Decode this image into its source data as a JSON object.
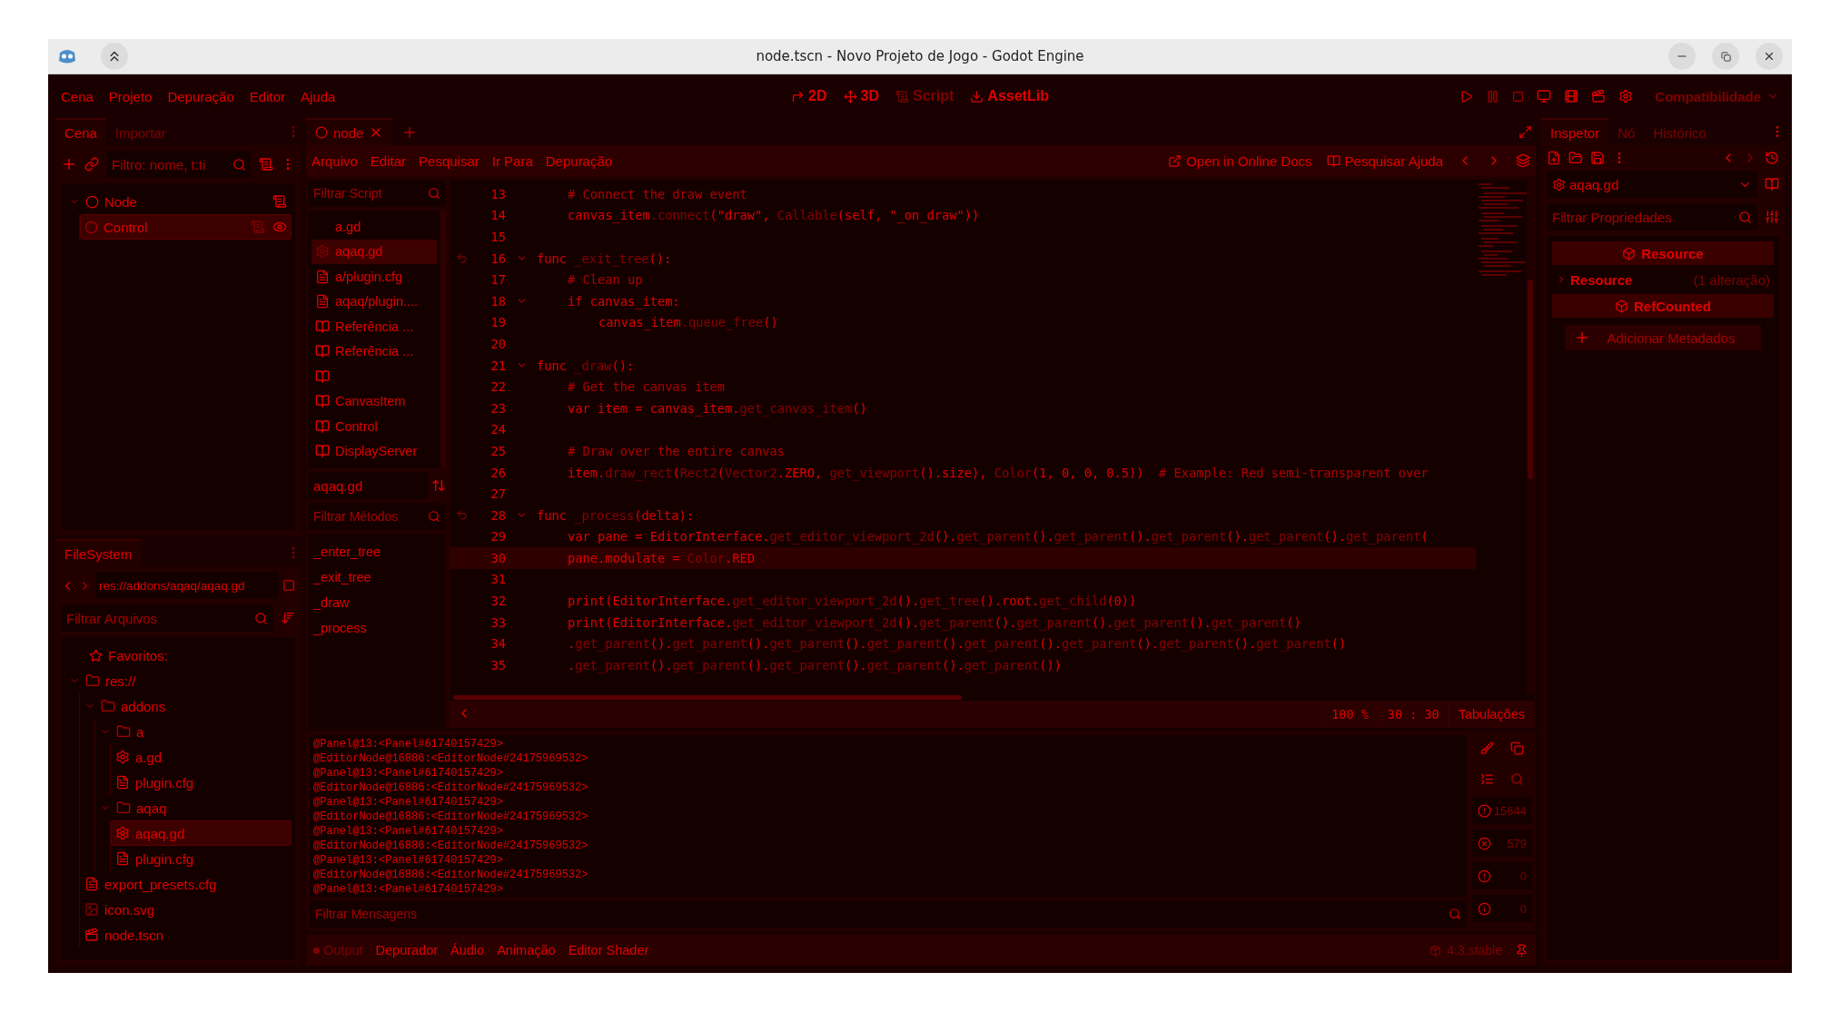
{
  "window": {
    "title": "node.tscn - Novo Projeto de Jogo - Godot Engine"
  },
  "menu": [
    "Cena",
    "Projeto",
    "Depuração",
    "Editor",
    "Ajuda"
  ],
  "workspaces": [
    {
      "label": "2D",
      "kind": "flat",
      "selected": false
    },
    {
      "label": "3D",
      "kind": "space",
      "selected": false
    },
    {
      "label": "Script",
      "kind": "script",
      "selected": true
    },
    {
      "label": "AssetLib",
      "kind": "assetlib",
      "selected": false
    }
  ],
  "renderer": "Compatibilidade",
  "scene_dock": {
    "tabs": [
      {
        "label": "Cena",
        "selected": true
      },
      {
        "label": "Importar",
        "selected": false
      }
    ],
    "filter_placeholder": "Filtro: nome, t:ti",
    "tree": [
      {
        "label": "Node",
        "kind": "root",
        "selected": false,
        "expanded": true,
        "children": [
          {
            "label": "Control",
            "kind": "child",
            "selected": true
          }
        ]
      }
    ]
  },
  "filesystem": {
    "tabs": [
      {
        "label": "FileSystem",
        "selected": true
      }
    ],
    "path": "res://addons/aqaq/aqaq.gd",
    "filter_placeholder": "Filtrar Arquivos",
    "favorites": "Favoritos:",
    "tree": [
      {
        "label": "res://",
        "kind": "folder",
        "selected": false,
        "expanded": true,
        "children": [
          {
            "label": "addons",
            "kind": "folder",
            "selected": false,
            "expanded": true,
            "children": [
              {
                "label": "a",
                "kind": "folder",
                "selected": false,
                "expanded": true,
                "children": [
                  {
                    "label": "a.gd",
                    "kind": "script",
                    "selected": false
                  },
                  {
                    "label": "plugin.cfg",
                    "kind": "config",
                    "selected": false
                  }
                ]
              },
              {
                "label": "aqaq",
                "kind": "folder",
                "selected": false,
                "expanded": true,
                "children": [
                  {
                    "label": "aqaq.gd",
                    "kind": "script",
                    "selected": true
                  },
                  {
                    "label": "plugin.cfg",
                    "kind": "config",
                    "selected": false
                  }
                ]
              }
            ]
          },
          {
            "label": "export_presets.cfg",
            "kind": "config",
            "selected": false
          },
          {
            "label": "icon.svg",
            "kind": "image",
            "selected": false
          },
          {
            "label": "node.tscn",
            "kind": "scene",
            "selected": false
          }
        ]
      }
    ]
  },
  "editor_tabs": [
    {
      "label": "node",
      "selected": true
    }
  ],
  "script_menu": [
    "Arquivo",
    "Editar",
    "Pesquisar",
    "Ir Para",
    "Depuração"
  ],
  "script_links": [
    {
      "label": "Open in Online Docs",
      "kind": "online"
    },
    {
      "label": "Pesquisar Ajuda",
      "kind": "help"
    }
  ],
  "script_list": {
    "filter_placeholder": "Filtrar Script",
    "items": [
      {
        "label": "a.gd",
        "kind": "plain",
        "selected": false
      },
      {
        "label": "aqaq.gd",
        "kind": "script",
        "selected": true
      },
      {
        "label": "a/plugin.cfg",
        "kind": "config",
        "selected": false
      },
      {
        "label": "aqaq/plugin....",
        "kind": "config",
        "selected": false
      },
      {
        "label": "Referência ...",
        "kind": "doc",
        "selected": false
      },
      {
        "label": "Referência ...",
        "kind": "doc",
        "selected": false
      },
      {
        "kind": "doc",
        "selected": false
      },
      {
        "label": "CanvasItem",
        "kind": "doc",
        "selected": false
      },
      {
        "label": "Control",
        "kind": "doc",
        "selected": false
      },
      {
        "label": "DisplayServer",
        "kind": "doc",
        "selected": false
      }
    ],
    "current": "aqaq.gd",
    "methods_placeholder": "Filtrar Métodos",
    "methods": [
      "_enter_tree",
      "_exit_tree",
      "_draw",
      "_process"
    ]
  },
  "code": [
    {
      "n": "13",
      "fold": false,
      "override": false,
      "current": false,
      "segs": [
        {
          "t": "\t# Connect the draw event",
          "kind": "comment"
        }
      ]
    },
    {
      "n": "14",
      "fold": false,
      "override": false,
      "current": false,
      "segs": [
        {
          "t": "\tcanvas_item",
          "kind": "plain"
        },
        {
          "t": ".connect",
          "kind": "call"
        },
        {
          "t": "(\"draw\", ",
          "kind": "plain"
        },
        {
          "t": "Callable",
          "kind": "call"
        },
        {
          "t": "(self, \"_on_draw\"))",
          "kind": "plain"
        }
      ]
    },
    {
      "n": "15",
      "fold": false,
      "override": false,
      "current": false
    },
    {
      "n": "16",
      "fold": true,
      "override": true,
      "current": false,
      "segs": [
        {
          "t": "func ",
          "kind": "plain"
        },
        {
          "t": "_exit_tree",
          "kind": "call"
        },
        {
          "t": "():",
          "kind": "plain"
        }
      ]
    },
    {
      "n": "17",
      "fold": false,
      "override": false,
      "current": false,
      "segs": [
        {
          "t": "\t# Clean up",
          "kind": "comment"
        }
      ]
    },
    {
      "n": "18",
      "fold": true,
      "override": false,
      "current": false,
      "segs": [
        {
          "t": "\tif canvas_item:",
          "kind": "plain"
        }
      ]
    },
    {
      "n": "19",
      "fold": false,
      "override": false,
      "current": false,
      "segs": [
        {
          "t": "\t\tcanvas_item",
          "kind": "plain"
        },
        {
          "t": ".queue_free",
          "kind": "call"
        },
        {
          "t": "()",
          "kind": "plain"
        }
      ]
    },
    {
      "n": "20",
      "fold": false,
      "override": false,
      "current": false
    },
    {
      "n": "21",
      "fold": true,
      "override": false,
      "current": false,
      "segs": [
        {
          "t": "func ",
          "kind": "plain"
        },
        {
          "t": "_draw",
          "kind": "call"
        },
        {
          "t": "():",
          "kind": "plain"
        }
      ]
    },
    {
      "n": "22",
      "fold": false,
      "override": false,
      "current": false,
      "segs": [
        {
          "t": "\t# Get the canvas item",
          "kind": "comment"
        }
      ]
    },
    {
      "n": "23",
      "fold": false,
      "override": false,
      "current": false,
      "segs": [
        {
          "t": "\tvar item = canvas_item.",
          "kind": "plain"
        },
        {
          "t": "get_canvas_item",
          "kind": "call"
        },
        {
          "t": "()",
          "kind": "plain"
        }
      ]
    },
    {
      "n": "24",
      "fold": false,
      "override": false,
      "current": false
    },
    {
      "n": "25",
      "fold": false,
      "override": false,
      "current": false,
      "segs": [
        {
          "t": "\t# Draw over the entire canvas",
          "kind": "comment"
        }
      ]
    },
    {
      "n": "26",
      "fold": false,
      "override": false,
      "current": false,
      "segs": [
        {
          "t": "\titem.",
          "kind": "plain"
        },
        {
          "t": "draw_rect",
          "kind": "call"
        },
        {
          "t": "(",
          "kind": "plain"
        },
        {
          "t": "Rect2",
          "kind": "call"
        },
        {
          "t": "(",
          "kind": "plain"
        },
        {
          "t": "Vector2",
          "kind": "call"
        },
        {
          "t": ".ZERO, ",
          "kind": "plain"
        },
        {
          "t": "get_viewport",
          "kind": "call"
        },
        {
          "t": "().size), ",
          "kind": "plain"
        },
        {
          "t": "Color",
          "kind": "call"
        },
        {
          "t": "(1, 0, 0, 0.5))  ",
          "kind": "plain"
        },
        {
          "t": "# Example: Red semi-transparent over",
          "kind": "comment"
        }
      ]
    },
    {
      "n": "27",
      "fold": false,
      "override": false,
      "current": false
    },
    {
      "n": "28",
      "fold": true,
      "override": true,
      "current": false,
      "segs": [
        {
          "t": "func ",
          "kind": "plain"
        },
        {
          "t": "_process",
          "kind": "call"
        },
        {
          "t": "(delta):",
          "kind": "plain"
        }
      ]
    },
    {
      "n": "29",
      "fold": false,
      "override": false,
      "current": false,
      "segs": [
        {
          "t": "\tvar pane = EditorInterface.",
          "kind": "plain"
        },
        {
          "t": "get_editor_viewport_2d",
          "kind": "call"
        },
        {
          "t": "().",
          "kind": "plain"
        },
        {
          "t": "get_parent",
          "kind": "call"
        },
        {
          "t": "().",
          "kind": "plain"
        },
        {
          "t": "get_parent",
          "kind": "call"
        },
        {
          "t": "().",
          "kind": "plain"
        },
        {
          "t": "get_parent",
          "kind": "call"
        },
        {
          "t": "().",
          "kind": "plain"
        },
        {
          "t": "get_parent",
          "kind": "call"
        },
        {
          "t": "().",
          "kind": "plain"
        },
        {
          "t": "get_parent",
          "kind": "call"
        },
        {
          "t": "(",
          "kind": "plain"
        }
      ]
    },
    {
      "n": "30",
      "fold": false,
      "override": false,
      "current": true,
      "segs": [
        {
          "t": "\tpane.modulate = ",
          "kind": "plain"
        },
        {
          "t": "Color",
          "kind": "call"
        },
        {
          "t": ".RED",
          "kind": "plain"
        }
      ]
    },
    {
      "n": "31",
      "fold": false,
      "override": false,
      "current": false
    },
    {
      "n": "32",
      "fold": false,
      "override": false,
      "current": false,
      "segs": [
        {
          "t": "\tprint(EditorInterface.",
          "kind": "plain"
        },
        {
          "t": "get_editor_viewport_2d",
          "kind": "call"
        },
        {
          "t": "().",
          "kind": "plain"
        },
        {
          "t": "get_tree",
          "kind": "call"
        },
        {
          "t": "().root.",
          "kind": "plain"
        },
        {
          "t": "get_child",
          "kind": "call"
        },
        {
          "t": "(0))",
          "kind": "plain"
        }
      ]
    },
    {
      "n": "33",
      "fold": false,
      "override": false,
      "current": false,
      "segs": [
        {
          "t": "\tprint(EditorInterface.",
          "kind": "plain"
        },
        {
          "t": "get_editor_viewport_2d",
          "kind": "call"
        },
        {
          "t": "().",
          "kind": "plain"
        },
        {
          "t": "get_parent",
          "kind": "call"
        },
        {
          "t": "().",
          "kind": "plain"
        },
        {
          "t": "get_parent",
          "kind": "call"
        },
        {
          "t": "().",
          "kind": "plain"
        },
        {
          "t": "get_parent",
          "kind": "call"
        },
        {
          "t": "().",
          "kind": "plain"
        },
        {
          "t": "get_parent",
          "kind": "call"
        },
        {
          "t": "()",
          "kind": "plain"
        }
      ]
    },
    {
      "n": "34",
      "fold": false,
      "override": false,
      "current": false,
      "segs": [
        {
          "t": "\t.",
          "kind": "plain"
        },
        {
          "t": "get_parent",
          "kind": "call"
        },
        {
          "t": "().",
          "kind": "plain"
        },
        {
          "t": "get_parent",
          "kind": "call"
        },
        {
          "t": "().",
          "kind": "plain"
        },
        {
          "t": "get_parent",
          "kind": "call"
        },
        {
          "t": "().",
          "kind": "plain"
        },
        {
          "t": "get_parent",
          "kind": "call"
        },
        {
          "t": "().",
          "kind": "plain"
        },
        {
          "t": "get_parent",
          "kind": "call"
        },
        {
          "t": "().",
          "kind": "plain"
        },
        {
          "t": "get_parent",
          "kind": "call"
        },
        {
          "t": "().",
          "kind": "plain"
        },
        {
          "t": "get_parent",
          "kind": "call"
        },
        {
          "t": "().",
          "kind": "plain"
        },
        {
          "t": "get_parent",
          "kind": "call"
        },
        {
          "t": "()",
          "kind": "plain"
        }
      ]
    },
    {
      "n": "35",
      "fold": false,
      "override": false,
      "current": false,
      "segs": [
        {
          "t": "\t.",
          "kind": "plain"
        },
        {
          "t": "get_parent",
          "kind": "call"
        },
        {
          "t": "().",
          "kind": "plain"
        },
        {
          "t": "get_parent",
          "kind": "call"
        },
        {
          "t": "().",
          "kind": "plain"
        },
        {
          "t": "get_parent",
          "kind": "call"
        },
        {
          "t": "().",
          "kind": "plain"
        },
        {
          "t": "get_parent",
          "kind": "call"
        },
        {
          "t": "().",
          "kind": "plain"
        },
        {
          "t": "get_parent",
          "kind": "call"
        },
        {
          "t": "())",
          "kind": "plain"
        }
      ]
    }
  ],
  "code_status": {
    "zoom": "100 %",
    "line": "30 :",
    "column": "30",
    "indent_mode": "Tabulações"
  },
  "output": {
    "lines": [
      "@Panel@13:<Panel#61740157429>",
      "@EditorNode@16886:<EditorNode#24175969532>",
      "@Panel@13:<Panel#61740157429>",
      "@EditorNode@16886:<EditorNode#24175969532>",
      "@Panel@13:<Panel#61740157429>",
      "@EditorNode@16886:<EditorNode#24175969532>",
      "@Panel@13:<Panel#61740157429>",
      "@EditorNode@16886:<EditorNode#24175969532>",
      "@Panel@13:<Panel#61740157429>",
      "@EditorNode@16886:<EditorNode#24175969532>",
      "@Panel@13:<Panel#61740157429>"
    ],
    "filter_placeholder": "Filtrar Mensagens",
    "counters": [
      {
        "kind": "message",
        "count": "15644"
      },
      {
        "kind": "error",
        "count": "579"
      },
      {
        "kind": "warning",
        "count": "0"
      },
      {
        "kind": "info",
        "count": "0"
      }
    ]
  },
  "bottom_tabs": [
    {
      "label": "Output",
      "selected": true
    },
    {
      "label": "Depurador",
      "selected": false
    },
    {
      "label": "Áudio",
      "selected": false
    },
    {
      "label": "Animação",
      "selected": false
    },
    {
      "label": "Editor Shader",
      "selected": false
    }
  ],
  "version": "4.3.stable",
  "inspector": {
    "tabs": [
      {
        "label": "Inspetor",
        "selected": true
      },
      {
        "label": "Nó",
        "selected": false
      },
      {
        "label": "Histórico",
        "selected": false
      }
    ],
    "resource": "aqaq.gd",
    "filter_placeholder": "Filtrar Propriedades",
    "sections": [
      {
        "kind": "category",
        "label": "Resource"
      },
      {
        "kind": "group",
        "label": "Resource",
        "note": "(1 alteração)"
      },
      {
        "kind": "category",
        "label": "RefCounted"
      }
    ],
    "add_button": "Adicionar Metadados"
  }
}
